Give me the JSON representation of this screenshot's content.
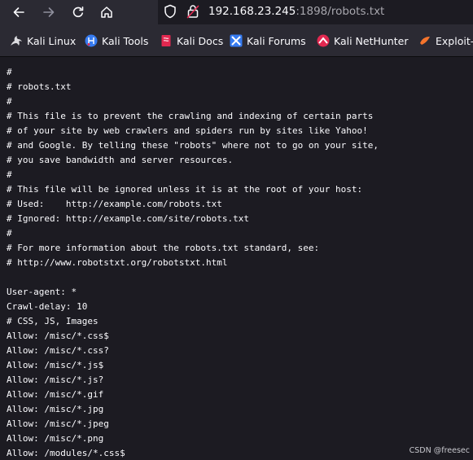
{
  "browser": {
    "url_host": "192.168.23.245",
    "url_path": ":1898/robots.txt"
  },
  "bookmarks": [
    {
      "label": "Kali Linux",
      "icon": "kali-dragon-icon"
    },
    {
      "label": "Kali Tools",
      "icon": "kali-tools-icon"
    },
    {
      "label": "Kali Docs",
      "icon": "kali-docs-icon"
    },
    {
      "label": "Kali Forums",
      "icon": "kali-forums-icon"
    },
    {
      "label": "Kali NetHunter",
      "icon": "kali-nethunter-icon"
    },
    {
      "label": "Exploit-",
      "icon": "exploit-db-icon"
    }
  ],
  "robots_lines": [
    "#",
    "# robots.txt",
    "#",
    "# This file is to prevent the crawling and indexing of certain parts",
    "# of your site by web crawlers and spiders run by sites like Yahoo!",
    "# and Google. By telling these \"robots\" where not to go on your site,",
    "# you save bandwidth and server resources.",
    "#",
    "# This file will be ignored unless it is at the root of your host:",
    "# Used:    http://example.com/robots.txt",
    "# Ignored: http://example.com/site/robots.txt",
    "#",
    "# For more information about the robots.txt standard, see:",
    "# http://www.robotstxt.org/robotstxt.html",
    "",
    "User-agent: *",
    "Crawl-delay: 10",
    "# CSS, JS, Images",
    "Allow: /misc/*.css$",
    "Allow: /misc/*.css?",
    "Allow: /misc/*.js$",
    "Allow: /misc/*.js?",
    "Allow: /misc/*.gif",
    "Allow: /misc/*.jpg",
    "Allow: /misc/*.jpeg",
    "Allow: /misc/*.png",
    "Allow: /modules/*.css$"
  ],
  "watermark": "CSDN @freesec",
  "colors": {
    "toolbar_bg": "#2b2a33",
    "page_bg": "#1c1b22",
    "text": "#fbfbfe",
    "muted_text": "#a7a6ad"
  }
}
